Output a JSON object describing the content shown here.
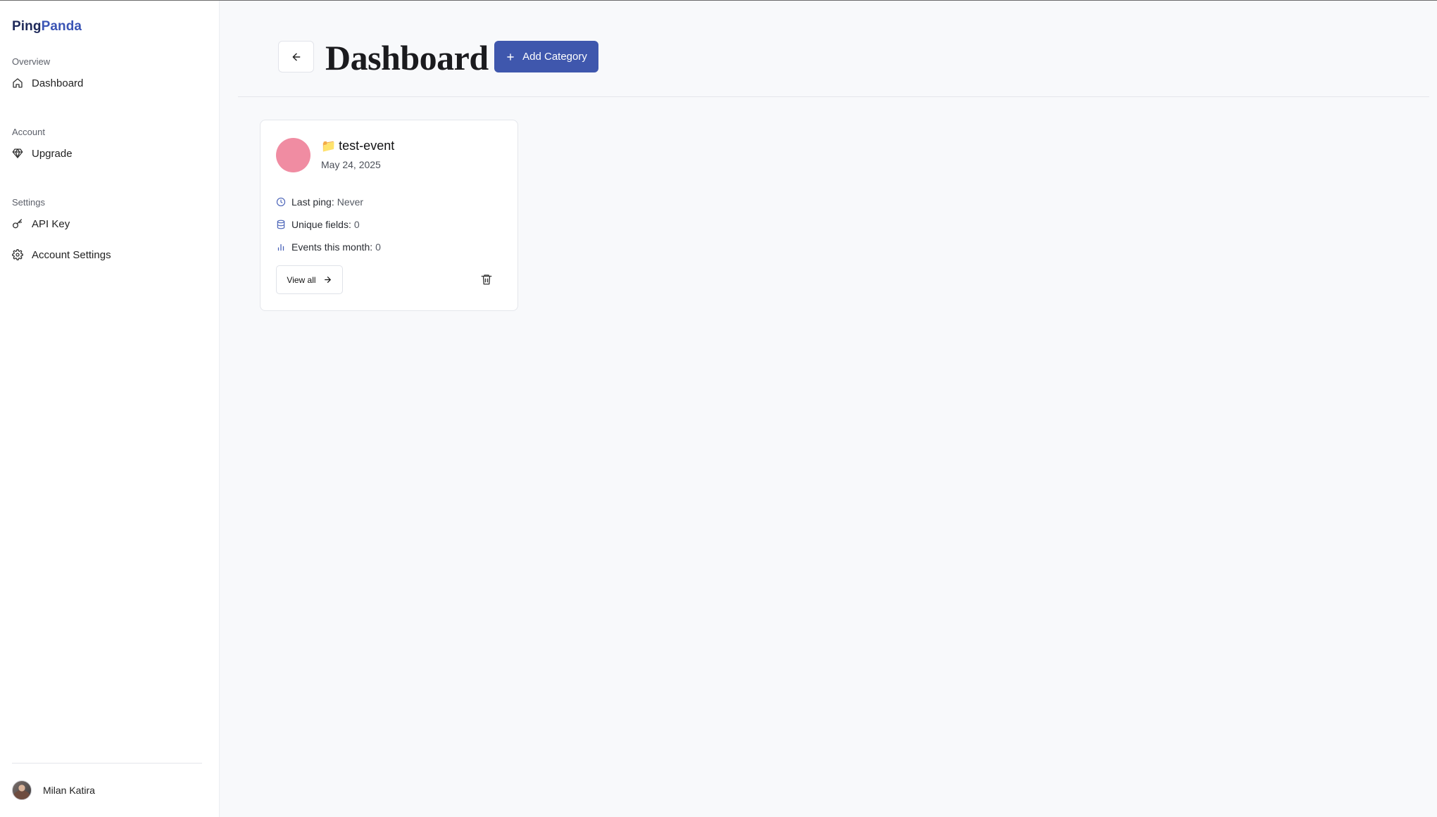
{
  "brand": {
    "part1": "Ping",
    "part2": "Panda"
  },
  "sidebar": {
    "groups": [
      {
        "label": "Overview",
        "items": [
          {
            "label": "Dashboard",
            "icon": "home-icon"
          }
        ]
      },
      {
        "label": "Account",
        "items": [
          {
            "label": "Upgrade",
            "icon": "gem-icon"
          }
        ]
      },
      {
        "label": "Settings",
        "items": [
          {
            "label": "API Key",
            "icon": "key-icon"
          },
          {
            "label": "Account Settings",
            "icon": "gear-icon"
          }
        ]
      }
    ],
    "user": {
      "name": "Milan Katira"
    }
  },
  "header": {
    "title": "Dashboard",
    "add_button_label": "Add Category"
  },
  "categories": [
    {
      "emoji": "📁",
      "name": "test-event",
      "date": "May 24, 2025",
      "color": "#f08ca2",
      "stats": {
        "last_ping_label": "Last ping:",
        "last_ping_value": "Never",
        "unique_fields_label": "Unique fields:",
        "unique_fields_value": "0",
        "events_label": "Events this month:",
        "events_value": "0"
      },
      "view_all_label": "View all"
    }
  ],
  "colors": {
    "accent": "#3f57ad",
    "brand_dark": "#1f2a5a",
    "brand_light": "#3b55b5",
    "background": "#f8f9fb"
  }
}
